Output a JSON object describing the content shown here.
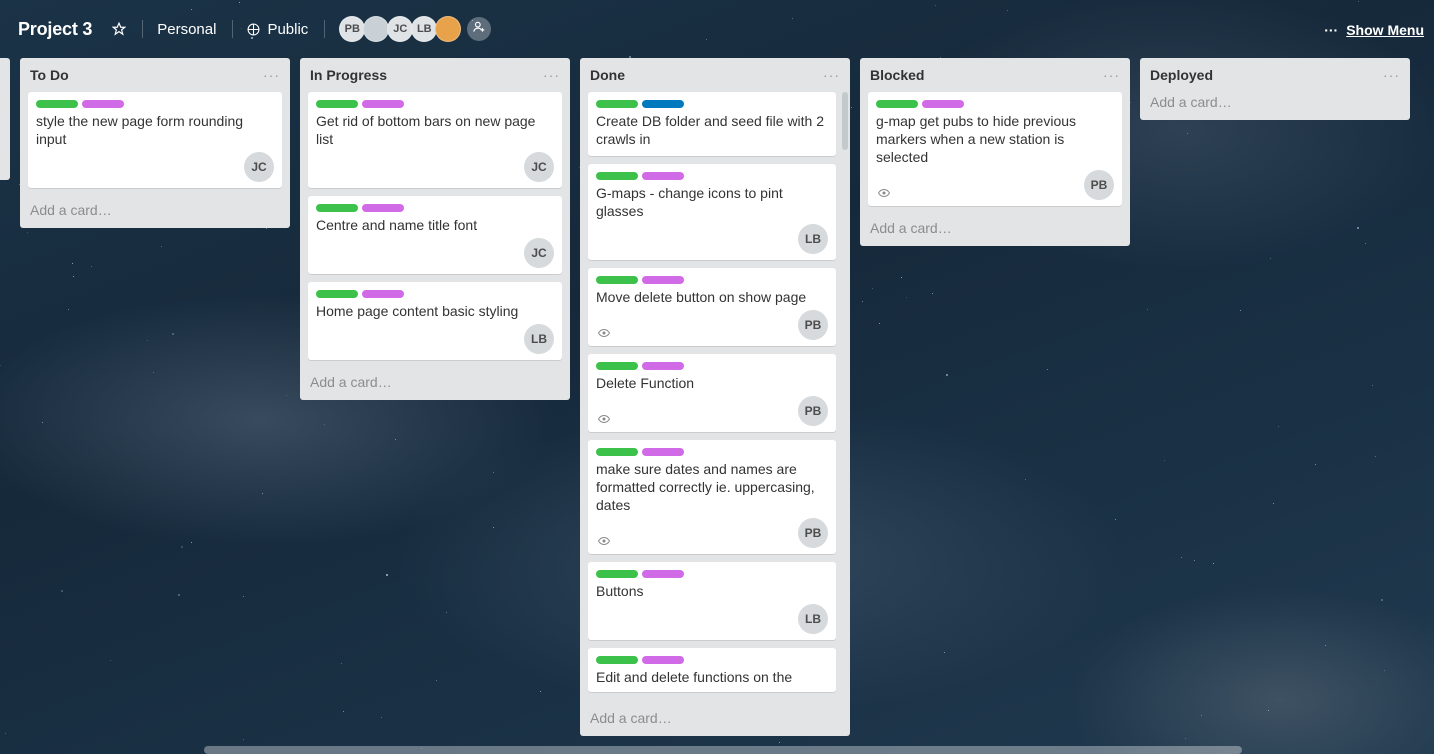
{
  "header": {
    "title": "Project 3",
    "team": "Personal",
    "visibility": "Public",
    "members": [
      "PB",
      "",
      "JC",
      "LB",
      ""
    ],
    "show_menu": "Show Menu",
    "menu_dots": "···"
  },
  "lists": [
    {
      "title": "To Do",
      "add": "Add a card…",
      "cards": [
        {
          "labels": [
            "green",
            "purple"
          ],
          "text": "style the new page form rounding input",
          "eye": false,
          "member": "JC"
        }
      ]
    },
    {
      "title": "In Progress",
      "add": "Add a card…",
      "cards": [
        {
          "labels": [
            "green",
            "purple"
          ],
          "text": "Get rid of bottom bars on new page list",
          "eye": false,
          "member": "JC"
        },
        {
          "labels": [
            "green",
            "purple"
          ],
          "text": "Centre and name title font",
          "eye": false,
          "member": "JC"
        },
        {
          "labels": [
            "green",
            "purple"
          ],
          "text": "Home page content basic styling",
          "eye": false,
          "member": "LB"
        }
      ]
    },
    {
      "title": "Done",
      "add": "Add a card…",
      "cards": [
        {
          "labels": [
            "green",
            "blue"
          ],
          "text": "Create DB folder and seed file with 2 crawls in",
          "eye": false,
          "member": ""
        },
        {
          "labels": [
            "green",
            "purple"
          ],
          "text": "G-maps - change icons to pint glasses",
          "eye": false,
          "member": "LB"
        },
        {
          "labels": [
            "green",
            "purple"
          ],
          "text": "Move delete button on show page",
          "eye": true,
          "member": "PB"
        },
        {
          "labels": [
            "green",
            "purple"
          ],
          "text": "Delete Function",
          "eye": true,
          "member": "PB"
        },
        {
          "labels": [
            "green",
            "purple"
          ],
          "text": "make sure dates and names are formatted correctly ie. uppercasing, dates",
          "eye": true,
          "member": "PB"
        },
        {
          "labels": [
            "green",
            "purple"
          ],
          "text": "Buttons",
          "eye": false,
          "member": "LB"
        },
        {
          "labels": [
            "green",
            "purple"
          ],
          "text": "Edit and delete functions on the",
          "eye": false,
          "member": ""
        }
      ]
    },
    {
      "title": "Blocked",
      "add": "Add a card…",
      "cards": [
        {
          "labels": [
            "green",
            "purple"
          ],
          "text": "g-map get pubs to hide previous markers when a new station is selected",
          "eye": true,
          "member": "PB"
        }
      ]
    },
    {
      "title": "Deployed",
      "add": "Add a card…",
      "cards": []
    }
  ],
  "colors": {
    "green": "#3cc24a",
    "purple": "#d06ae6",
    "blue": "#0079bf"
  },
  "icons": {
    "star": "star-icon",
    "globe": "globe-icon",
    "eye": "eye-icon",
    "invite": "add-member-icon"
  }
}
